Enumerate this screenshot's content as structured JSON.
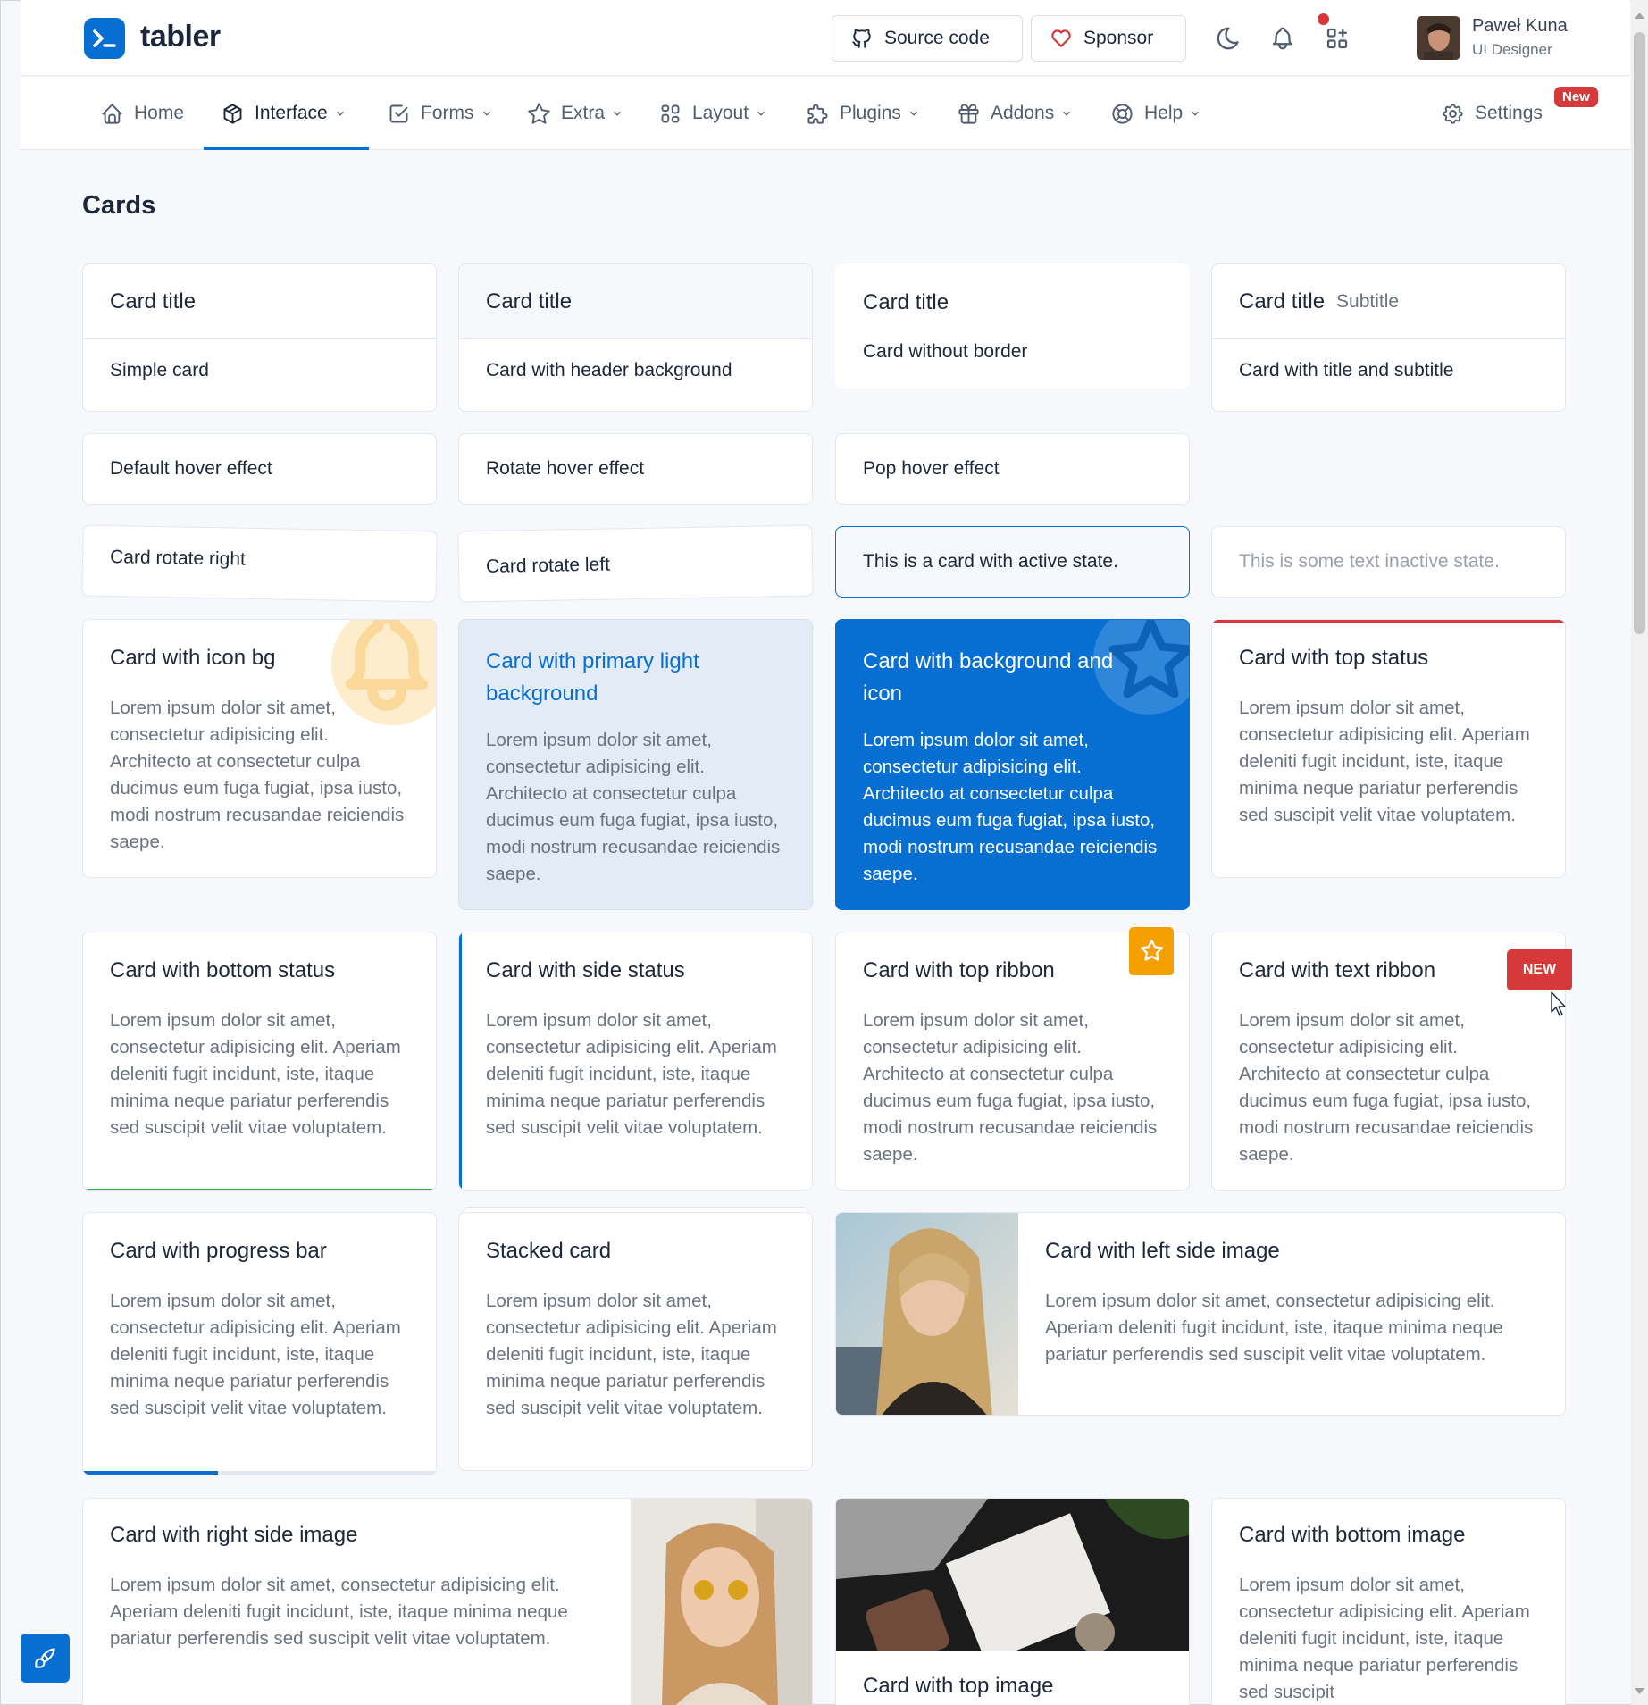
{
  "brand": {
    "name": "tabler"
  },
  "header": {
    "source_code": "Source code",
    "sponsor": "Sponsor",
    "user_name": "Paweł Kuna",
    "user_role": "UI Designer"
  },
  "nav": {
    "items": [
      {
        "label": "Home",
        "icon": "home-icon"
      },
      {
        "label": "Interface",
        "icon": "package-icon"
      },
      {
        "label": "Forms",
        "icon": "checkbox-icon"
      },
      {
        "label": "Extra",
        "icon": "star-icon"
      },
      {
        "label": "Layout",
        "icon": "layout-icon"
      },
      {
        "label": "Plugins",
        "icon": "puzzle-icon"
      },
      {
        "label": "Addons",
        "icon": "gift-icon"
      },
      {
        "label": "Help",
        "icon": "lifebuoy-icon"
      }
    ],
    "settings": "Settings",
    "new_badge": "New"
  },
  "page": {
    "title": "Cards"
  },
  "cards": {
    "simple": {
      "title": "Card title",
      "body": "Simple card"
    },
    "header_bg": {
      "title": "Card title",
      "body": "Card with header background"
    },
    "no_border": {
      "title": "Card title",
      "body": "Card without border"
    },
    "subtitle": {
      "title": "Card title",
      "subtitle": "Subtitle",
      "body": "Card with title and subtitle"
    },
    "hover_default": "Default hover effect",
    "hover_rotate": "Rotate hover effect",
    "hover_pop": "Pop hover effect",
    "rotate_right": "Card rotate right",
    "rotate_left": "Card rotate left",
    "active": "This is a card with active state.",
    "inactive": "This is some text inactive state.",
    "icon_bg": {
      "title": "Card with icon bg",
      "body": "Lorem ipsum dolor sit amet, consectetur adipisicing elit. Architecto at consectetur culpa ducimus eum fuga fugiat, ipsa iusto, modi nostrum recusandae reiciendis saepe."
    },
    "primary_light": {
      "title": "Card with primary light background",
      "body": "Lorem ipsum dolor sit amet, consectetur adipisicing elit. Architecto at consectetur culpa ducimus eum fuga fugiat, ipsa iusto, modi nostrum recusandae reiciendis saepe."
    },
    "bg_icon": {
      "title": "Card with background and icon",
      "body": "Lorem ipsum dolor sit amet, consectetur adipisicing elit. Architecto at consectetur culpa ducimus eum fuga fugiat, ipsa iusto, modi nostrum recusandae reiciendis saepe."
    },
    "top_status": {
      "title": "Card with top status",
      "body": "Lorem ipsum dolor sit amet, consectetur adipisicing elit. Aperiam deleniti fugit incidunt, iste, itaque minima neque pariatur perferendis sed suscipit velit vitae voluptatem."
    },
    "bottom_status": {
      "title": "Card with bottom status",
      "body": "Lorem ipsum dolor sit amet, consectetur adipisicing elit. Aperiam deleniti fugit incidunt, iste, itaque minima neque pariatur perferendis sed suscipit velit vitae voluptatem."
    },
    "side_status": {
      "title": "Card with side status",
      "body": "Lorem ipsum dolor sit amet, consectetur adipisicing elit. Aperiam deleniti fugit incidunt, iste, itaque minima neque pariatur perferendis sed suscipit velit vitae voluptatem."
    },
    "top_ribbon": {
      "title": "Card with top ribbon",
      "body": "Lorem ipsum dolor sit amet, consectetur adipisicing elit. Architecto at consectetur culpa ducimus eum fuga fugiat, ipsa iusto, modi nostrum recusandae reiciendis saepe."
    },
    "text_ribbon": {
      "title": "Card with text ribbon",
      "ribbon": "NEW",
      "body": "Lorem ipsum dolor sit amet, consectetur adipisicing elit. Architecto at consectetur culpa ducimus eum fuga fugiat, ipsa iusto, modi nostrum recusandae reiciendis saepe."
    },
    "progress": {
      "title": "Card with progress bar",
      "progress_fraction": 0.38,
      "body": "Lorem ipsum dolor sit amet, consectetur adipisicing elit. Aperiam deleniti fugit incidunt, iste, itaque minima neque pariatur perferendis sed suscipit velit vitae voluptatem."
    },
    "stacked": {
      "title": "Stacked card",
      "body": "Lorem ipsum dolor sit amet, consectetur adipisicing elit. Aperiam deleniti fugit incidunt, iste, itaque minima neque pariatur perferendis sed suscipit velit vitae voluptatem."
    },
    "left_image": {
      "title": "Card with left side image",
      "body": "Lorem ipsum dolor sit amet, consectetur adipisicing elit. Aperiam deleniti fugit incidunt, iste, itaque minima neque pariatur perferendis sed suscipit velit vitae voluptatem."
    },
    "right_image": {
      "title": "Card with right side image",
      "body": "Lorem ipsum dolor sit amet, consectetur adipisicing elit. Aperiam deleniti fugit incidunt, iste, itaque minima neque pariatur perferendis sed suscipit velit vitae voluptatem."
    },
    "top_image": {
      "title": "Card with top image"
    },
    "bottom_image": {
      "title": "Card with bottom image",
      "body": "Lorem ipsum dolor sit amet, consectetur adipisicing elit. Aperiam deleniti fugit incidunt, iste, itaque minima neque pariatur perferendis sed suscipit"
    }
  },
  "colors": {
    "primary": "#066fd1",
    "danger": "#d63939",
    "success": "#2fb344",
    "warning": "#f59f00"
  }
}
